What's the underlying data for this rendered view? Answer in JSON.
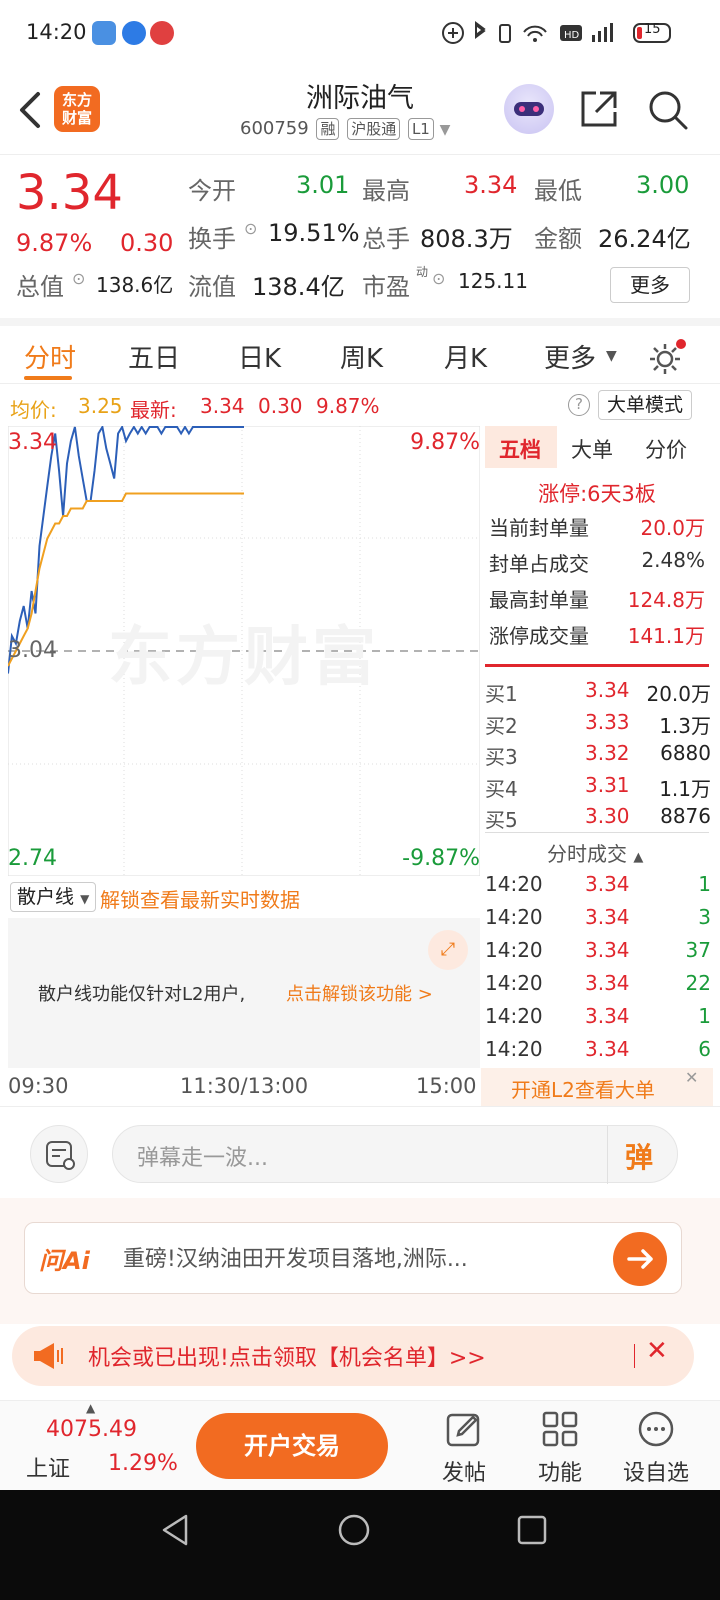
{
  "status": {
    "time": "14:20",
    "battery": "15"
  },
  "header": {
    "logo_line1": "东方",
    "logo_line2": "财富",
    "title": "洲际油气",
    "code": "600759",
    "tag1": "融",
    "tag2": "沪股通",
    "tag3": "L1"
  },
  "quote": {
    "price": "3.34",
    "pct": "9.87%",
    "change": "0.30",
    "open_label": "今开",
    "open": "3.01",
    "high_label": "最高",
    "high": "3.34",
    "low_label": "最低",
    "low": "3.00",
    "turnover_label": "换手",
    "turnover": "19.51%",
    "volume_label": "总手",
    "volume": "808.3万",
    "amount_label": "金额",
    "amount": "26.24亿",
    "mktcap_label": "总值",
    "mktcap": "138.6亿",
    "float_label": "流值",
    "float": "138.4亿",
    "pe_label": "市盈",
    "pe_sup": "动",
    "pe": "125.11",
    "more": "更多"
  },
  "tabs": [
    "分时",
    "五日",
    "日K",
    "周K",
    "月K",
    "更多"
  ],
  "avgbar": {
    "avg_label": "均价:",
    "avg": "3.25",
    "latest_label": "最新:",
    "latest": "3.34",
    "change": "0.30",
    "pct": "9.87%",
    "mode": "大单模式"
  },
  "chart": {
    "y_top": "3.34",
    "y_mid": "3.04",
    "y_bot": "2.74",
    "pct_top": "9.87%",
    "pct_bot": "-9.87%",
    "watermark": "东方财富"
  },
  "chart_data": {
    "type": "line",
    "title": "",
    "ylim": [
      2.74,
      3.34
    ],
    "prev_close": 3.04,
    "series": [
      {
        "values": [
          3.01,
          3.06,
          3.05,
          3.08,
          3.1,
          3.07,
          3.12,
          3.09,
          3.18,
          3.22,
          3.26,
          3.3,
          3.33,
          3.28,
          3.22,
          3.29,
          3.32,
          3.34,
          3.3,
          3.27,
          3.24,
          3.24,
          3.28,
          3.33,
          3.34,
          3.31,
          3.29,
          3.27,
          3.33,
          3.34,
          3.32,
          3.33,
          3.34,
          3.33,
          3.34,
          3.33,
          3.34,
          3.34,
          3.34,
          3.33,
          3.34,
          3.34,
          3.34,
          3.34,
          3.33,
          3.34,
          3.33,
          3.34,
          3.34,
          3.34,
          3.34,
          3.34,
          3.34,
          3.34,
          3.34,
          3.34,
          3.34,
          3.34,
          3.34,
          3.34,
          3.34
        ]
      },
      {
        "values": [
          3.02,
          3.03,
          3.04,
          3.05,
          3.06,
          3.07,
          3.09,
          3.12,
          3.15,
          3.17,
          3.19,
          3.2,
          3.21,
          3.21,
          3.22,
          3.22,
          3.23,
          3.23,
          3.23,
          3.23,
          3.24,
          3.24,
          3.24,
          3.24,
          3.24,
          3.24,
          3.24,
          3.24,
          3.24,
          3.24,
          3.25,
          3.25,
          3.25,
          3.25,
          3.25,
          3.25,
          3.25,
          3.25,
          3.25,
          3.25,
          3.25,
          3.25,
          3.25,
          3.25,
          3.25,
          3.25,
          3.25,
          3.25,
          3.25,
          3.25,
          3.25,
          3.25,
          3.25,
          3.25,
          3.25,
          3.25,
          3.25,
          3.25,
          3.25,
          3.25,
          3.25
        ]
      }
    ],
    "total_points": 121
  },
  "rightpanel": {
    "tabs": [
      "五档",
      "大单",
      "分价"
    ],
    "limitup": "涨停:6天3板",
    "stats": [
      {
        "label": "当前封单量",
        "value": "20.0万"
      },
      {
        "label": "封单占成交",
        "value": "2.48%"
      },
      {
        "label": "最高封单量",
        "value": "124.8万"
      },
      {
        "label": "涨停成交量",
        "value": "141.1万"
      }
    ],
    "bids": [
      {
        "label": "买1",
        "price": "3.34",
        "vol": "20.0万"
      },
      {
        "label": "买2",
        "price": "3.33",
        "vol": "1.3万"
      },
      {
        "label": "买3",
        "price": "3.32",
        "vol": "6880"
      },
      {
        "label": "买4",
        "price": "3.31",
        "vol": "1.1万"
      },
      {
        "label": "买5",
        "price": "3.30",
        "vol": "8876"
      }
    ],
    "ticks_title": "分时成交",
    "ticks": [
      {
        "time": "14:20",
        "price": "3.34",
        "vol": "1"
      },
      {
        "time": "14:20",
        "price": "3.34",
        "vol": "3"
      },
      {
        "time": "14:20",
        "price": "3.34",
        "vol": "37"
      },
      {
        "time": "14:20",
        "price": "3.34",
        "vol": "22"
      },
      {
        "time": "14:20",
        "price": "3.34",
        "vol": "1"
      },
      {
        "time": "14:20",
        "price": "3.34",
        "vol": "6"
      }
    ],
    "l2_banner": "开通L2查看大单"
  },
  "sanhu": {
    "select": "散户线",
    "unlock": "解锁查看最新实时数据",
    "notice": "散户线功能仅针对L2用户,",
    "notice_link": "点击解锁该功能 >"
  },
  "timeaxis": {
    "start": "09:30",
    "mid": "11:30/13:00",
    "end": "15:00"
  },
  "danmu": {
    "placeholder": "弹幕走一波...",
    "btn": "弹"
  },
  "ai": {
    "brand": "问Ai",
    "text": "重磅!汉纳油田开发项目落地,洲际..."
  },
  "opp": {
    "text": "机会或已出现!点击领取【机会名单】>>"
  },
  "toolbar": {
    "index_value": "4075.49",
    "index_name": "上证",
    "index_pct": "1.29%",
    "trade": "开户交易",
    "post": "发帖",
    "func": "功能",
    "watch": "设自选"
  }
}
